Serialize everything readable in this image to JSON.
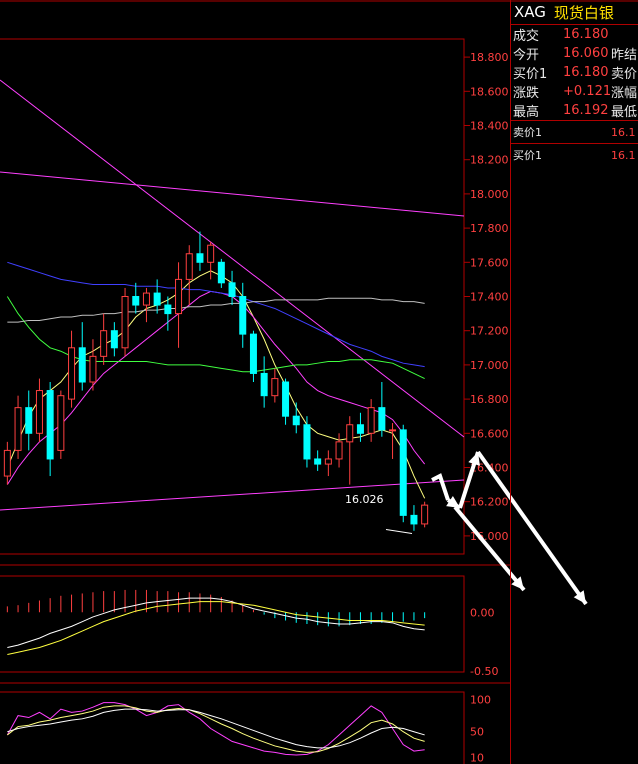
{
  "quote": {
    "code": "XAG",
    "name": "现货白银",
    "rows": [
      {
        "label": "成交",
        "value": "16.180",
        "label2": ""
      },
      {
        "label": "今开",
        "value": "16.060",
        "label2": "昨结"
      },
      {
        "label": "买价1",
        "value": "16.180",
        "label2": "卖价"
      },
      {
        "label": "涨跌",
        "value": "+0.121",
        "label2": "涨幅"
      },
      {
        "label": "最高",
        "value": "16.192",
        "label2": "最低"
      }
    ],
    "ask_label": "卖价1",
    "ask_value": "16.1",
    "bid_label": "买价1",
    "bid_value": "16.1"
  },
  "colors": {
    "up": "#ff4040",
    "down": "#00ffff",
    "frame": "#b00000"
  },
  "chart_data": [
    {
      "type": "candlestick",
      "panel": "price",
      "ylim": [
        15.9,
        18.9
      ],
      "yticks": [
        "16.000",
        "16.200",
        "16.400",
        "16.600",
        "16.800",
        "17.000",
        "17.200",
        "17.400",
        "17.600",
        "17.800",
        "18.000",
        "18.200",
        "18.400",
        "18.600",
        "18.800"
      ],
      "annotation": {
        "text": "16.026",
        "value": 16.026
      },
      "candles": [
        [
          16.35,
          16.55,
          16.3,
          16.5
        ],
        [
          16.5,
          16.82,
          16.45,
          16.75
        ],
        [
          16.75,
          16.85,
          16.5,
          16.6
        ],
        [
          16.6,
          16.92,
          16.55,
          16.85
        ],
        [
          16.85,
          16.9,
          16.35,
          16.45
        ],
        [
          16.5,
          16.85,
          16.45,
          16.82
        ],
        [
          16.8,
          17.2,
          16.75,
          17.1
        ],
        [
          17.1,
          17.25,
          16.85,
          16.9
        ],
        [
          16.9,
          17.15,
          16.85,
          17.05
        ],
        [
          17.05,
          17.3,
          17.0,
          17.2
        ],
        [
          17.2,
          17.25,
          17.05,
          17.1
        ],
        [
          17.1,
          17.45,
          17.05,
          17.4
        ],
        [
          17.4,
          17.48,
          17.3,
          17.35
        ],
        [
          17.35,
          17.45,
          17.25,
          17.42
        ],
        [
          17.42,
          17.5,
          17.3,
          17.35
        ],
        [
          17.35,
          17.4,
          17.2,
          17.3
        ],
        [
          17.3,
          17.6,
          17.1,
          17.5
        ],
        [
          17.5,
          17.7,
          17.35,
          17.65
        ],
        [
          17.65,
          17.78,
          17.55,
          17.6
        ],
        [
          17.6,
          17.72,
          17.5,
          17.7
        ],
        [
          17.6,
          17.62,
          17.45,
          17.48
        ],
        [
          17.48,
          17.55,
          17.35,
          17.4
        ],
        [
          17.4,
          17.48,
          17.1,
          17.18
        ],
        [
          17.18,
          17.2,
          16.9,
          16.95
        ],
        [
          16.95,
          17.05,
          16.75,
          16.82
        ],
        [
          16.82,
          16.98,
          16.78,
          16.92
        ],
        [
          16.9,
          16.92,
          16.65,
          16.7
        ],
        [
          16.7,
          16.78,
          16.6,
          16.65
        ],
        [
          16.65,
          16.7,
          16.4,
          16.45
        ],
        [
          16.45,
          16.5,
          16.38,
          16.42
        ],
        [
          16.42,
          16.5,
          16.35,
          16.45
        ],
        [
          16.45,
          16.6,
          16.4,
          16.55
        ],
        [
          16.55,
          16.7,
          16.3,
          16.65
        ],
        [
          16.65,
          16.72,
          16.55,
          16.6
        ],
        [
          16.6,
          16.8,
          16.55,
          16.75
        ],
        [
          16.75,
          16.9,
          16.58,
          16.62
        ],
        [
          16.62,
          16.66,
          16.45,
          16.62
        ],
        [
          16.62,
          16.65,
          16.08,
          16.12
        ],
        [
          16.12,
          16.18,
          16.03,
          16.07
        ],
        [
          16.07,
          16.2,
          16.05,
          16.18
        ]
      ],
      "ma_lines": [
        {
          "color": "#ffff80",
          "values": [
            16.4,
            16.55,
            16.7,
            16.8,
            16.85,
            16.9,
            16.98,
            17.05,
            17.08,
            17.12,
            17.15,
            17.2,
            17.28,
            17.33,
            17.35,
            17.38,
            17.42,
            17.48,
            17.52,
            17.55,
            17.52,
            17.48,
            17.4,
            17.28,
            17.15,
            17.0,
            16.88,
            16.75,
            16.65,
            16.6,
            16.58,
            16.56,
            16.57,
            16.58,
            16.6,
            16.62,
            16.6,
            16.5,
            16.35,
            16.22
          ]
        },
        {
          "color": "#ff40ff",
          "values": [
            16.3,
            16.4,
            16.48,
            16.55,
            16.6,
            16.65,
            16.72,
            16.8,
            16.88,
            16.95,
            17.0,
            17.05,
            17.1,
            17.15,
            17.2,
            17.25,
            17.3,
            17.35,
            17.4,
            17.43,
            17.42,
            17.4,
            17.35,
            17.28,
            17.2,
            17.12,
            17.05,
            16.98,
            16.9,
            16.85,
            16.82,
            16.8,
            16.78,
            16.76,
            16.74,
            16.72,
            16.68,
            16.6,
            16.5,
            16.42
          ]
        },
        {
          "color": "#40ff40",
          "values": [
            17.4,
            17.3,
            17.22,
            17.15,
            17.1,
            17.08,
            17.05,
            17.03,
            17.02,
            17.02,
            17.02,
            17.02,
            17.02,
            17.02,
            17.01,
            17.0,
            17.0,
            17.0,
            17.0,
            16.99,
            16.98,
            16.97,
            16.96,
            16.96,
            16.97,
            16.98,
            16.99,
            17.0,
            17.0,
            17.01,
            17.02,
            17.02,
            17.03,
            17.03,
            17.03,
            17.02,
            17.01,
            16.98,
            16.95,
            16.92
          ]
        },
        {
          "color": "#4040ff",
          "values": [
            17.6,
            17.58,
            17.56,
            17.54,
            17.52,
            17.5,
            17.49,
            17.48,
            17.47,
            17.47,
            17.47,
            17.47,
            17.46,
            17.46,
            17.46,
            17.45,
            17.45,
            17.44,
            17.44,
            17.43,
            17.42,
            17.41,
            17.39,
            17.37,
            17.35,
            17.33,
            17.3,
            17.27,
            17.24,
            17.21,
            17.18,
            17.15,
            17.12,
            17.1,
            17.08,
            17.05,
            17.03,
            17.01,
            17.0,
            16.99
          ]
        },
        {
          "color": "#c0c0c0",
          "values": [
            17.25,
            17.25,
            17.26,
            17.26,
            17.27,
            17.28,
            17.28,
            17.29,
            17.29,
            17.3,
            17.3,
            17.31,
            17.31,
            17.32,
            17.32,
            17.33,
            17.33,
            17.34,
            17.34,
            17.35,
            17.35,
            17.36,
            17.36,
            17.37,
            17.37,
            17.38,
            17.38,
            17.38,
            17.38,
            17.38,
            17.39,
            17.39,
            17.39,
            17.39,
            17.39,
            17.38,
            17.38,
            17.37,
            17.37,
            17.36
          ]
        }
      ]
    },
    {
      "type": "bar",
      "panel": "macd",
      "ylim": [
        -0.5,
        0.3
      ],
      "yticks": [
        "0.00",
        "-0.50"
      ],
      "values": [
        0.05,
        0.06,
        0.08,
        0.1,
        0.12,
        0.14,
        0.15,
        0.16,
        0.17,
        0.18,
        0.18,
        0.19,
        0.19,
        0.19,
        0.18,
        0.18,
        0.17,
        0.17,
        0.16,
        0.15,
        0.13,
        0.1,
        0.06,
        0.02,
        -0.02,
        -0.05,
        -0.07,
        -0.09,
        -0.1,
        -0.11,
        -0.12,
        -0.12,
        -0.11,
        -0.1,
        -0.1,
        -0.09,
        -0.08,
        -0.08,
        -0.07,
        -0.05
      ],
      "lines": [
        {
          "color": "#ffffff",
          "values": [
            -0.3,
            -0.28,
            -0.25,
            -0.22,
            -0.18,
            -0.15,
            -0.12,
            -0.08,
            -0.04,
            -0.01,
            0.02,
            0.04,
            0.06,
            0.08,
            0.09,
            0.1,
            0.11,
            0.12,
            0.12,
            0.12,
            0.11,
            0.09,
            0.06,
            0.03,
            0.01,
            -0.01,
            -0.03,
            -0.05,
            -0.06,
            -0.08,
            -0.09,
            -0.1,
            -0.1,
            -0.09,
            -0.08,
            -0.08,
            -0.09,
            -0.12,
            -0.14,
            -0.15
          ]
        },
        {
          "color": "#ffff40",
          "values": [
            -0.36,
            -0.34,
            -0.32,
            -0.3,
            -0.27,
            -0.24,
            -0.2,
            -0.16,
            -0.12,
            -0.08,
            -0.05,
            -0.02,
            0.01,
            0.03,
            0.05,
            0.06,
            0.07,
            0.08,
            0.09,
            0.09,
            0.09,
            0.08,
            0.07,
            0.06,
            0.04,
            0.02,
            0.0,
            -0.02,
            -0.03,
            -0.04,
            -0.05,
            -0.06,
            -0.07,
            -0.07,
            -0.07,
            -0.07,
            -0.08,
            -0.09,
            -0.1,
            -0.11
          ]
        }
      ]
    },
    {
      "type": "line",
      "panel": "kdj",
      "ylim": [
        0,
        110
      ],
      "yticks": [
        "100",
        "50",
        "10"
      ],
      "series": [
        {
          "color": "#ff40ff",
          "values": [
            45,
            75,
            72,
            80,
            70,
            85,
            80,
            82,
            88,
            95,
            95,
            92,
            85,
            75,
            80,
            90,
            92,
            80,
            70,
            55,
            45,
            35,
            30,
            25,
            20,
            18,
            15,
            14,
            15,
            20,
            30,
            45,
            60,
            75,
            90,
            80,
            55,
            30,
            20,
            22
          ]
        },
        {
          "color": "#ffff80",
          "values": [
            45,
            58,
            60,
            65,
            68,
            72,
            75,
            78,
            82,
            88,
            90,
            90,
            87,
            82,
            80,
            84,
            86,
            84,
            78,
            70,
            62,
            55,
            47,
            40,
            34,
            28,
            24,
            20,
            18,
            19,
            24,
            32,
            42,
            52,
            64,
            68,
            62,
            50,
            40,
            35
          ]
        },
        {
          "color": "#ffffff",
          "values": [
            50,
            55,
            58,
            60,
            62,
            65,
            68,
            70,
            74,
            80,
            83,
            85,
            85,
            84,
            82,
            83,
            84,
            84,
            80,
            75,
            70,
            64,
            58,
            52,
            46,
            40,
            35,
            30,
            27,
            25,
            25,
            28,
            33,
            40,
            48,
            55,
            57,
            55,
            50,
            45
          ]
        }
      ]
    }
  ]
}
